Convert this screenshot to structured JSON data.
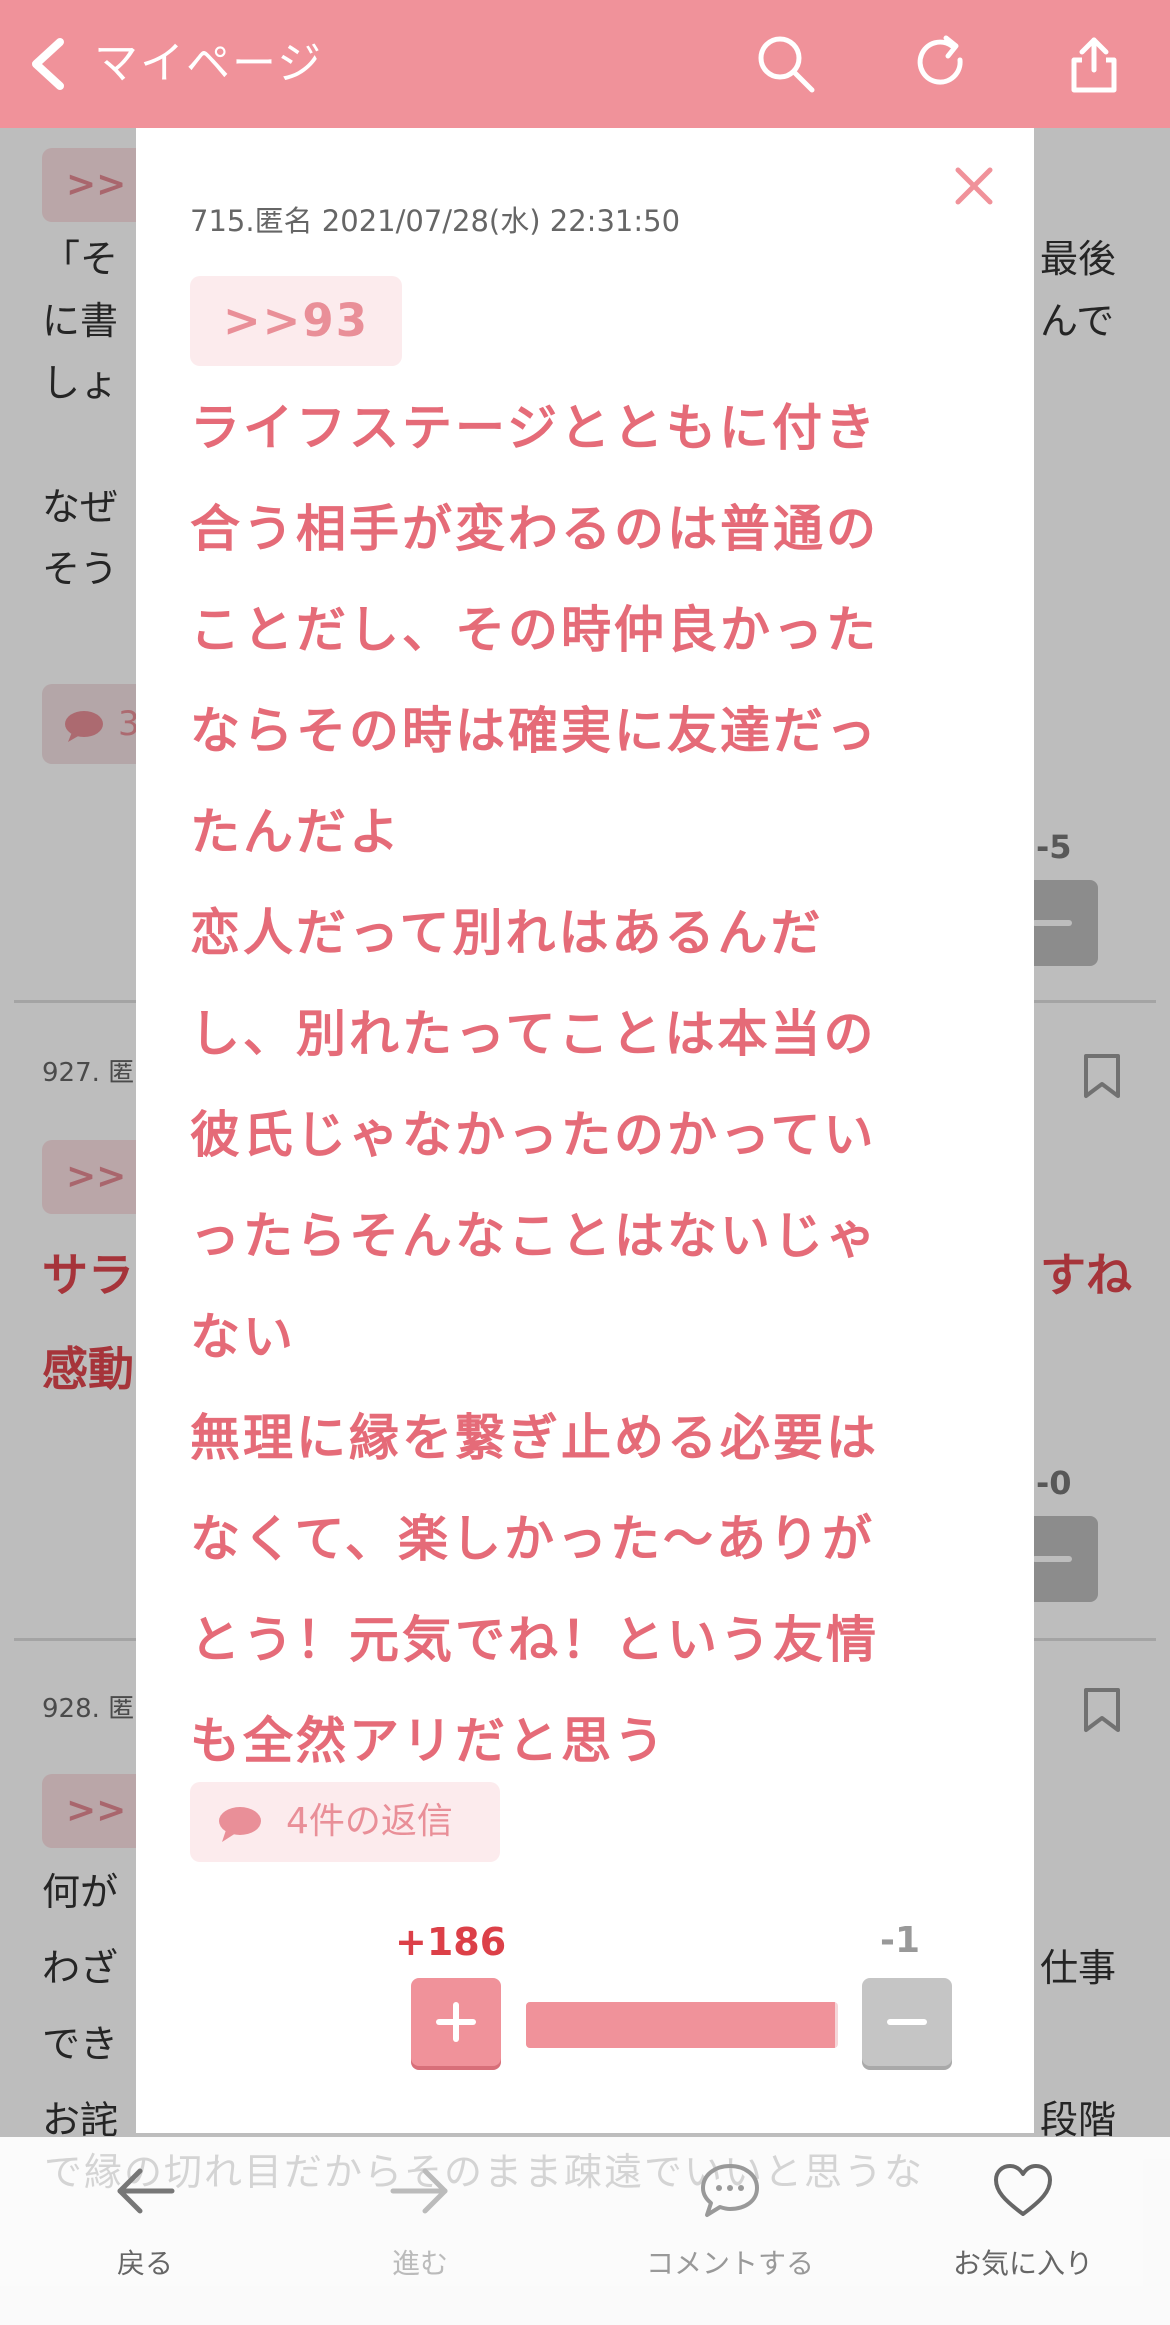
{
  "header": {
    "back_label": "マイページ",
    "bg_color": "#f0929a",
    "icons": [
      "chevron-left-icon",
      "search-icon",
      "refresh-icon",
      "share-icon"
    ]
  },
  "background": {
    "post1": {
      "tag": ">>",
      "lines": [
        "「そ",
        "に書",
        "しょ",
        "",
        "なぜ",
        "そう"
      ],
      "right_lines": [
        "最後",
        "んで"
      ],
      "reply_chip": "3",
      "minus_count": "-5"
    },
    "post2": {
      "meta": "927. 匿",
      "tag": ">>",
      "lines": [
        "サラ",
        "感動"
      ],
      "right_lines": [
        "すね"
      ],
      "minus_count": "-0"
    },
    "post3": {
      "meta": "928. 匿",
      "tag": ">>",
      "lines": [
        "何が",
        "わざ",
        "でき",
        "お詫"
      ],
      "right_lines": [
        "仕事",
        "",
        "段階"
      ]
    },
    "ghost_text": "で縁の切れ目だからそのまま疎遠でいいと思うな"
  },
  "modal": {
    "meta": "715.匿名 2021/07/28(水) 22:31:50",
    "anchor": ">>93",
    "body_lines": [
      "ライフステージとともに付き",
      "合う相手が変わるのは普通の",
      "ことだし、その時仲良かった",
      "ならその時は確実に友達だっ",
      "たんだよ",
      "恋人だって別れはあるんだ",
      "し、別れたってことは本当の",
      "彼氏じゃなかったのかってい",
      "ったらそんなことはないじゃ",
      "ない",
      "無理に縁を繋ぎ止める必要は",
      "なくて、楽しかった〜ありが",
      "とう！元気でね！という友情",
      "も全然アリだと思う"
    ],
    "replies_label": "4件の返信",
    "plus_count": "+186",
    "minus_count": "-1",
    "plus_share": 0.99,
    "text_color": "#e56b78"
  },
  "bottom_nav": {
    "items": [
      {
        "label": "戻る",
        "icon": "arrow-left-icon"
      },
      {
        "label": "進む",
        "icon": "arrow-right-icon"
      },
      {
        "label": "コメントする",
        "icon": "comment-icon"
      },
      {
        "label": "お気に入り",
        "icon": "heart-icon"
      }
    ]
  }
}
